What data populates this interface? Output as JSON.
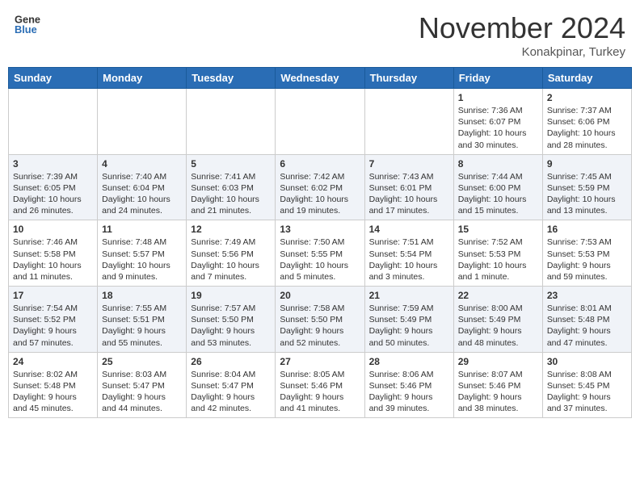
{
  "header": {
    "logo_general": "General",
    "logo_blue": "Blue",
    "month_title": "November 2024",
    "location": "Konakpinar, Turkey"
  },
  "weekdays": [
    "Sunday",
    "Monday",
    "Tuesday",
    "Wednesday",
    "Thursday",
    "Friday",
    "Saturday"
  ],
  "weeks": [
    [
      {
        "day": "",
        "info": ""
      },
      {
        "day": "",
        "info": ""
      },
      {
        "day": "",
        "info": ""
      },
      {
        "day": "",
        "info": ""
      },
      {
        "day": "",
        "info": ""
      },
      {
        "day": "1",
        "info": "Sunrise: 7:36 AM\nSunset: 6:07 PM\nDaylight: 10 hours and 30 minutes."
      },
      {
        "day": "2",
        "info": "Sunrise: 7:37 AM\nSunset: 6:06 PM\nDaylight: 10 hours and 28 minutes."
      }
    ],
    [
      {
        "day": "3",
        "info": "Sunrise: 7:39 AM\nSunset: 6:05 PM\nDaylight: 10 hours and 26 minutes."
      },
      {
        "day": "4",
        "info": "Sunrise: 7:40 AM\nSunset: 6:04 PM\nDaylight: 10 hours and 24 minutes."
      },
      {
        "day": "5",
        "info": "Sunrise: 7:41 AM\nSunset: 6:03 PM\nDaylight: 10 hours and 21 minutes."
      },
      {
        "day": "6",
        "info": "Sunrise: 7:42 AM\nSunset: 6:02 PM\nDaylight: 10 hours and 19 minutes."
      },
      {
        "day": "7",
        "info": "Sunrise: 7:43 AM\nSunset: 6:01 PM\nDaylight: 10 hours and 17 minutes."
      },
      {
        "day": "8",
        "info": "Sunrise: 7:44 AM\nSunset: 6:00 PM\nDaylight: 10 hours and 15 minutes."
      },
      {
        "day": "9",
        "info": "Sunrise: 7:45 AM\nSunset: 5:59 PM\nDaylight: 10 hours and 13 minutes."
      }
    ],
    [
      {
        "day": "10",
        "info": "Sunrise: 7:46 AM\nSunset: 5:58 PM\nDaylight: 10 hours and 11 minutes."
      },
      {
        "day": "11",
        "info": "Sunrise: 7:48 AM\nSunset: 5:57 PM\nDaylight: 10 hours and 9 minutes."
      },
      {
        "day": "12",
        "info": "Sunrise: 7:49 AM\nSunset: 5:56 PM\nDaylight: 10 hours and 7 minutes."
      },
      {
        "day": "13",
        "info": "Sunrise: 7:50 AM\nSunset: 5:55 PM\nDaylight: 10 hours and 5 minutes."
      },
      {
        "day": "14",
        "info": "Sunrise: 7:51 AM\nSunset: 5:54 PM\nDaylight: 10 hours and 3 minutes."
      },
      {
        "day": "15",
        "info": "Sunrise: 7:52 AM\nSunset: 5:53 PM\nDaylight: 10 hours and 1 minute."
      },
      {
        "day": "16",
        "info": "Sunrise: 7:53 AM\nSunset: 5:53 PM\nDaylight: 9 hours and 59 minutes."
      }
    ],
    [
      {
        "day": "17",
        "info": "Sunrise: 7:54 AM\nSunset: 5:52 PM\nDaylight: 9 hours and 57 minutes."
      },
      {
        "day": "18",
        "info": "Sunrise: 7:55 AM\nSunset: 5:51 PM\nDaylight: 9 hours and 55 minutes."
      },
      {
        "day": "19",
        "info": "Sunrise: 7:57 AM\nSunset: 5:50 PM\nDaylight: 9 hours and 53 minutes."
      },
      {
        "day": "20",
        "info": "Sunrise: 7:58 AM\nSunset: 5:50 PM\nDaylight: 9 hours and 52 minutes."
      },
      {
        "day": "21",
        "info": "Sunrise: 7:59 AM\nSunset: 5:49 PM\nDaylight: 9 hours and 50 minutes."
      },
      {
        "day": "22",
        "info": "Sunrise: 8:00 AM\nSunset: 5:49 PM\nDaylight: 9 hours and 48 minutes."
      },
      {
        "day": "23",
        "info": "Sunrise: 8:01 AM\nSunset: 5:48 PM\nDaylight: 9 hours and 47 minutes."
      }
    ],
    [
      {
        "day": "24",
        "info": "Sunrise: 8:02 AM\nSunset: 5:48 PM\nDaylight: 9 hours and 45 minutes."
      },
      {
        "day": "25",
        "info": "Sunrise: 8:03 AM\nSunset: 5:47 PM\nDaylight: 9 hours and 44 minutes."
      },
      {
        "day": "26",
        "info": "Sunrise: 8:04 AM\nSunset: 5:47 PM\nDaylight: 9 hours and 42 minutes."
      },
      {
        "day": "27",
        "info": "Sunrise: 8:05 AM\nSunset: 5:46 PM\nDaylight: 9 hours and 41 minutes."
      },
      {
        "day": "28",
        "info": "Sunrise: 8:06 AM\nSunset: 5:46 PM\nDaylight: 9 hours and 39 minutes."
      },
      {
        "day": "29",
        "info": "Sunrise: 8:07 AM\nSunset: 5:46 PM\nDaylight: 9 hours and 38 minutes."
      },
      {
        "day": "30",
        "info": "Sunrise: 8:08 AM\nSunset: 5:45 PM\nDaylight: 9 hours and 37 minutes."
      }
    ]
  ]
}
